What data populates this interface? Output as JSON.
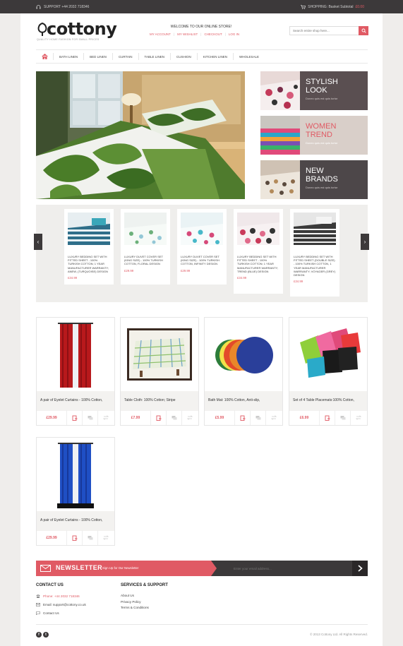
{
  "topbar": {
    "support": "SUPPORT +44 2032 718346",
    "shopping": "SHOPPING: Basket Subtotal",
    "subtotal": "£0.00"
  },
  "brand": {
    "name": "cottony",
    "tagline": "QUALITY HOME FASHION FOR SMALL PRICES"
  },
  "header": {
    "welcome": "WELCOME TO OUR ONLINE STORE!",
    "links": [
      "MY ACCOUNT",
      "MY WISHLIST",
      "CHECKOUT",
      "LOG IN"
    ],
    "search_placeholder": "Search entire shop here..."
  },
  "nav": {
    "items": [
      "BATH LINEN",
      "BED LINEN",
      "CURTAIN",
      "TABLE LINEN",
      "CUSHION",
      "KITCHEN LINEN",
      "WHOLESALE"
    ]
  },
  "promos": [
    {
      "title_1": "STYLISH",
      "title_2": "LOOK",
      "sub": "Donec quis est quis tortor",
      "title_color": "#ffffff",
      "bg": "#5a4f51"
    },
    {
      "title_1": "WOMEN",
      "title_2": "TREND",
      "sub": "Donec quis est quis tortor",
      "title_color": "#e05a64",
      "bg": "#d9cfc9"
    },
    {
      "title_1": "NEW",
      "title_2": "BRANDS",
      "sub": "Donec quis est quis tortor",
      "title_color": "#ffffff",
      "bg": "#4d4749"
    }
  ],
  "carousel": [
    {
      "name": "LUXURY BEDDING SET WITH FITTED SHEET - 100% TURKISH COTTON; 1 YEAR MANUFACTURER WARRANTY; ANEW, (TURQUOISE) DESIGN",
      "price": "£34.99"
    },
    {
      "name": "LUXURY DUVET COVER SET (KING SIZE) - 100% TURKISH COTTON, FLORAL DESIGN",
      "price": "£29.99"
    },
    {
      "name": "LUXURY DUVET COVER SET (KING SIZE) - 100% TURKISH COTTON, INFINITY DESIGN",
      "price": "£29.99"
    },
    {
      "name": "LUXURY BEDDING SET WITH FITTED SHEET - 100% TURKISH COTTON; 1 YEAR MANUFACTURER WARRANTY; TREND (BLUE) DESIGN",
      "price": "£34.99"
    },
    {
      "name": "LUXURY BEDDING SET WITH FITTED SHEET (DOUBLE SIZE) - 100% TURKISH COTTON, 1 YEAR MANUFACTURER WARRANTY; VOYAGER (GREY) DESIGN",
      "price": "£34.99"
    }
  ],
  "products": [
    {
      "title": "A pair of Eyelet Curtains - 100% Cotton,",
      "price": "£29.99"
    },
    {
      "title": "Table Cloth: 100% Cotton; Stripe",
      "price": "£7.99"
    },
    {
      "title": "Bath Mat: 100% Cotton, Anti-slip,",
      "price": "£5.99"
    },
    {
      "title": "Set of 4 Table Placemats:100% Cotton,",
      "price": "£6.99"
    },
    {
      "title": "A pair of Eyelet Curtains - 100% Cotton,",
      "price": "£29.99"
    }
  ],
  "newsletter": {
    "title": "NEWSLETTER",
    "sub": "Sign Up for Our Newsletter",
    "placeholder": "Enter your email address..."
  },
  "footer": {
    "contact_title": "CONTACT US",
    "phone": "Phone: +44 2032 718346",
    "email": "Email: support@cottony.co.uk",
    "contact": "Contact Us",
    "services_title": "SERVICES & SUPPORT",
    "services": [
      "About Us",
      "Privacy Policy",
      "Terms & Conditions"
    ],
    "copyright": "© 2013 Cottony Ltd. All Rights Reserved."
  },
  "colors": {
    "accent": "#e05a64",
    "dark": "#3c393a"
  }
}
